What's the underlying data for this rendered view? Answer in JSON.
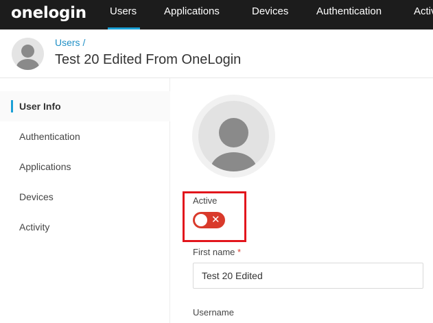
{
  "brand": {
    "logo_text": "onelogin"
  },
  "nav": {
    "items": [
      {
        "label": "Users",
        "active": true
      },
      {
        "label": "Applications"
      },
      {
        "label": "Devices"
      },
      {
        "label": "Authentication"
      },
      {
        "label": "Activity"
      }
    ]
  },
  "header": {
    "breadcrumb": "Users /",
    "title": "Test 20 Edited From OneLogin",
    "avatar_icon": "user-avatar-icon"
  },
  "sidebar": {
    "items": [
      {
        "label": "User Info",
        "active": true
      },
      {
        "label": "Authentication"
      },
      {
        "label": "Applications"
      },
      {
        "label": "Devices"
      },
      {
        "label": "Activity"
      }
    ]
  },
  "form": {
    "active_label": "Active",
    "active_toggle": {
      "state": "off",
      "icon": "close-icon",
      "glyph": "✕"
    },
    "first_name": {
      "label": "First name",
      "required_mark": "*",
      "value": "Test 20 Edited"
    },
    "username": {
      "label": "Username"
    }
  },
  "colors": {
    "nav_bg": "#1c1c1c",
    "accent": "#1aa0d6",
    "link": "#1e8fc6",
    "toggle_off": "#d93a2b",
    "highlight": "#e2151c"
  }
}
